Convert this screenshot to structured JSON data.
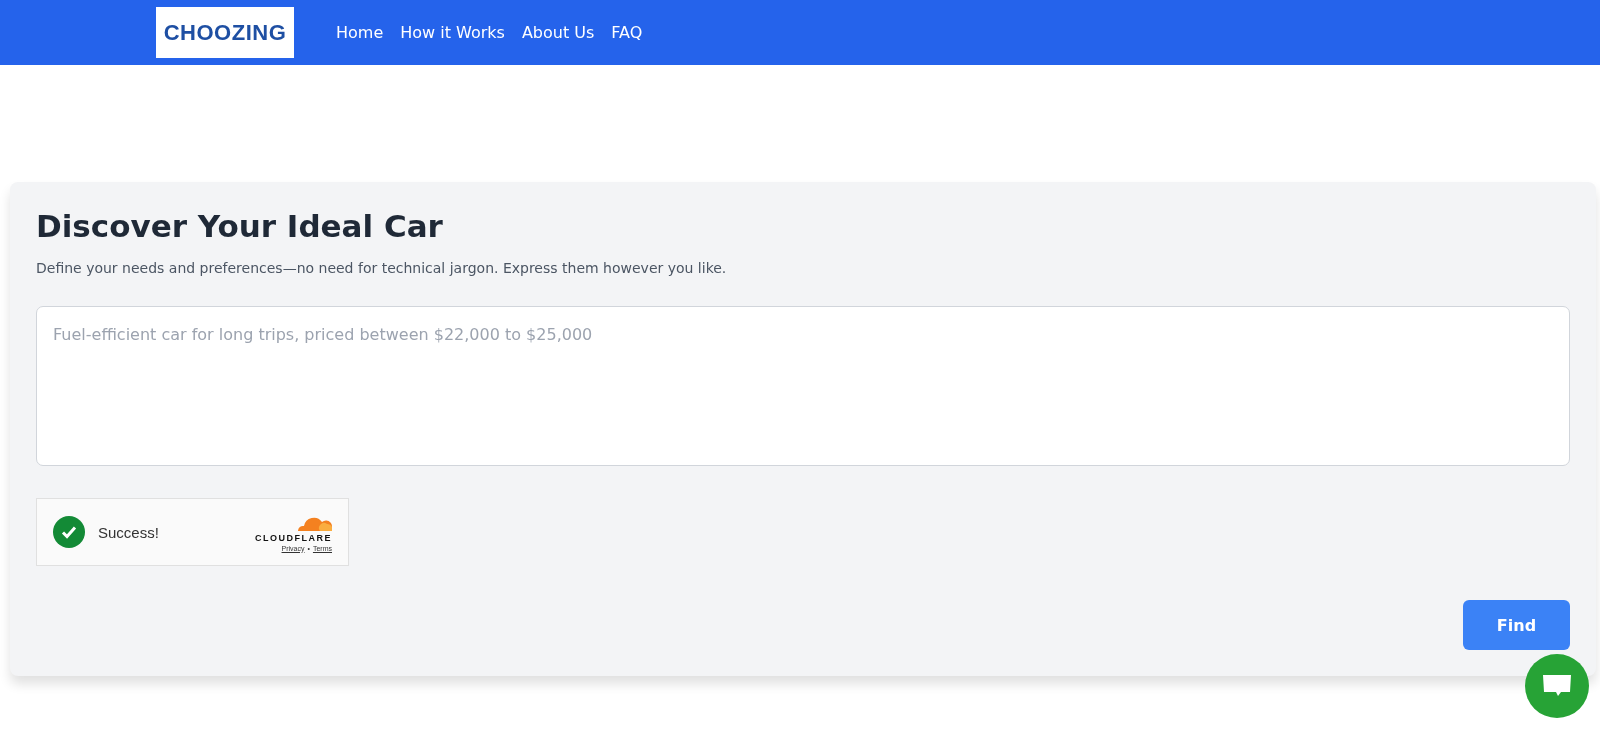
{
  "header": {
    "logo": "CHOOZING",
    "nav": [
      "Home",
      "How it Works",
      "About Us",
      "FAQ"
    ]
  },
  "card": {
    "title": "Discover Your Ideal Car",
    "subtitle": "Define your needs and preferences—no need for technical jargon. Express them however you like.",
    "input": {
      "placeholder": "Fuel-efficient car for long trips, priced between $22,000 to $25,000"
    },
    "captcha": {
      "checked": true,
      "status": "Success!",
      "brand": "CLOUDFLARE",
      "links": [
        "Privacy",
        "Terms"
      ],
      "separator": "•"
    },
    "button": "Find"
  }
}
